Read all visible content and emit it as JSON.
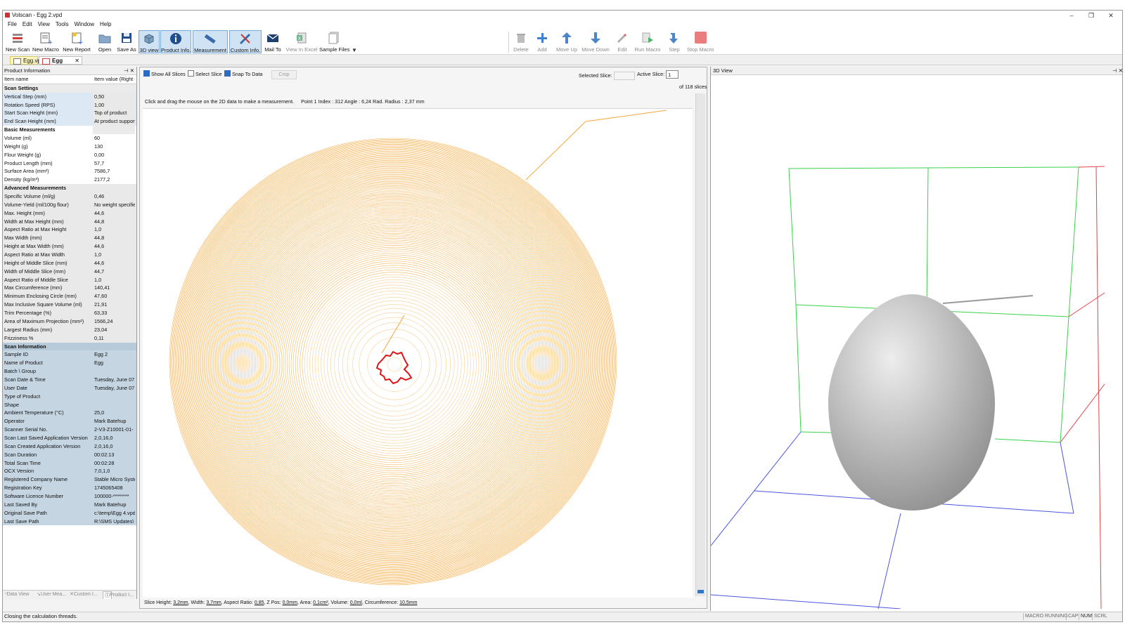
{
  "window": {
    "title": "Volscan - Egg 2.vpd",
    "controls": [
      "–",
      "❐",
      "✕"
    ]
  },
  "menu": [
    "File",
    "Edit",
    "View",
    "Tools",
    "Window",
    "Help"
  ],
  "toolbar": {
    "new_scan": "New Scan",
    "new_macro": "New Macro",
    "new_report": "New Report",
    "open": "Open",
    "save_as": "Save As",
    "view_3d": "3D view",
    "product_info": "Product Info.",
    "measurement": "Measurement",
    "custom_info": "Custom Info.",
    "mail_to": "Mail To",
    "view_in_excel": "View In Excel",
    "sample_files": "Sample Files",
    "delete": "Delete",
    "add": "Add",
    "move_up": "Move Up",
    "move_down": "Move Down",
    "edit": "Edit",
    "run_macro": "Run Macro",
    "step": "Step",
    "stop_macro": "Stop Macro"
  },
  "tabs": [
    {
      "label": "Egg.vpr"
    },
    {
      "label": "Egg 2.vpd",
      "close": "✕"
    }
  ],
  "left_panel": {
    "title": "Product Information",
    "header": {
      "name": "Item name",
      "value": "Item value (Right -"
    },
    "rows": [
      {
        "name": "Scan Settings",
        "value": "",
        "kind": "sec1"
      },
      {
        "name": "Vertical Step (mm)",
        "value": "0,50",
        "kind": "g1"
      },
      {
        "name": "Rotation Speed (RPS)",
        "value": "1,00",
        "kind": "g1"
      },
      {
        "name": "Start Scan Height (mm)",
        "value": "Top of product",
        "kind": "g1"
      },
      {
        "name": "End Scan Height (mm)",
        "value": "At product support",
        "kind": "g1"
      },
      {
        "name": "Basic Measurements",
        "value": "",
        "kind": "sec1w"
      },
      {
        "name": "Volume (ml)",
        "value": "60",
        "kind": "w"
      },
      {
        "name": "Weight (g)",
        "value": "130",
        "kind": "w"
      },
      {
        "name": "Flour Weight (g)",
        "value": "0,00",
        "kind": "w"
      },
      {
        "name": "Product Length (mm)",
        "value": "57,7",
        "kind": "w"
      },
      {
        "name": "Surface Area (mm²)",
        "value": "7586,7",
        "kind": "w"
      },
      {
        "name": "Density (kg/m³)",
        "value": "2177,2",
        "kind": "w"
      },
      {
        "name": "Advanced Measurements",
        "value": "",
        "kind": "sec2"
      },
      {
        "name": "Specific Volume (ml/g)",
        "value": "0,46",
        "kind": "g2"
      },
      {
        "name": "Volume-Yield (ml/100g flour)",
        "value": "No weight specified",
        "kind": "g2"
      },
      {
        "name": "Max. Height (mm)",
        "value": "44,6",
        "kind": "g2"
      },
      {
        "name": "Width at Max Height (mm)",
        "value": "44,8",
        "kind": "g2"
      },
      {
        "name": "Aspect Ratio at Max Height",
        "value": "1,0",
        "kind": "g2"
      },
      {
        "name": "Max Width (mm)",
        "value": "44,8",
        "kind": "g2"
      },
      {
        "name": "Height at Max Width (mm)",
        "value": "44,6",
        "kind": "g2"
      },
      {
        "name": "Aspect Ratio at Max Width",
        "value": "1,0",
        "kind": "g2"
      },
      {
        "name": "Height of Middle Slice (mm)",
        "value": "44,6",
        "kind": "g2"
      },
      {
        "name": "Width of Middle Slice (mm)",
        "value": "44,7",
        "kind": "g2"
      },
      {
        "name": "Aspect Ratio of Middle Slice",
        "value": "1,0",
        "kind": "g2"
      },
      {
        "name": "Max Circumference (mm)",
        "value": "140,41",
        "kind": "g2"
      },
      {
        "name": "Minimum Enclosing Circle (mm)",
        "value": "47,60",
        "kind": "g2"
      },
      {
        "name": "Max Inclusive Square Volume (ml)",
        "value": "21,91",
        "kind": "g2"
      },
      {
        "name": "Trim Percentage (%)",
        "value": "63,33",
        "kind": "g2"
      },
      {
        "name": "Area of Maximum Projection (mm²)",
        "value": "1566,24",
        "kind": "g2"
      },
      {
        "name": "Largest Radius (mm)",
        "value": "23,04",
        "kind": "g2"
      },
      {
        "name": "Frizziness %",
        "value": "0,11",
        "kind": "g2"
      },
      {
        "name": "Scan Information",
        "value": "",
        "kind": "sec3"
      },
      {
        "name": "Sample ID",
        "value": "Egg 2",
        "kind": "g3"
      },
      {
        "name": "Name of Product",
        "value": "Egg",
        "kind": "g3"
      },
      {
        "name": "Batch \\ Group",
        "value": "",
        "kind": "g3"
      },
      {
        "name": "Scan Date & Time",
        "value": "Tuesday, June 07,",
        "kind": "g3"
      },
      {
        "name": "User Date",
        "value": "Tuesday, June 07,",
        "kind": "g3"
      },
      {
        "name": "Type of Product",
        "value": "",
        "kind": "g3"
      },
      {
        "name": "Shape",
        "value": "",
        "kind": "g3"
      },
      {
        "name": "Ambient Temperature (°C)",
        "value": "25,0",
        "kind": "g3"
      },
      {
        "name": "Operator",
        "value": "Mark Batehup",
        "kind": "g3"
      },
      {
        "name": "Scanner Serial No.",
        "value": "2-V3-Z10001-01-",
        "kind": "g3"
      },
      {
        "name": "Scan Last Saved Application Version",
        "value": "2,0,16,0",
        "kind": "g3"
      },
      {
        "name": "Scan Created Application Version",
        "value": "2,0,16,0",
        "kind": "g3"
      },
      {
        "name": "Scan Duration",
        "value": "00:02:13",
        "kind": "g3"
      },
      {
        "name": "Total Scan Time",
        "value": "00:02:28",
        "kind": "g3"
      },
      {
        "name": "OCX Version",
        "value": "7,0,1,0",
        "kind": "g3"
      },
      {
        "name": "Registered Company Name",
        "value": "Stable Micro Systems",
        "kind": "g3"
      },
      {
        "name": "Registration Key",
        "value": "1745065408",
        "kind": "g3"
      },
      {
        "name": "Software Licence Number",
        "value": "100000-********",
        "kind": "g3"
      },
      {
        "name": "Last Saved By",
        "value": "Mark Batehup",
        "kind": "g3"
      },
      {
        "name": "Original Save Path",
        "value": "c:\\temp\\Egg 4.vpd",
        "kind": "g3"
      },
      {
        "name": "Last Save Path",
        "value": "R:\\SMS Updates\\",
        "kind": "g3"
      }
    ],
    "bottom_tabs": [
      "Data View",
      "User Mea...",
      "Custom I...",
      "Product I..."
    ]
  },
  "center": {
    "show_all_slices": "Show All Slices",
    "select_slice": "Select Slice",
    "snap_to_data": "Snap To Data",
    "crop": "Crop",
    "selected_slice_label": "Selected Slice:",
    "active_slice_label": "Active Slice:",
    "active_slice_value": "1",
    "slice_count": "of   118 slices",
    "hint": "Click and drag the mouse on the 2D data to make a measurement.",
    "point_info": "Point 1 Index : 312 Angle : 6,24 Rad. Radius : 2,37 mm",
    "status": {
      "slice_height_label": "Slice Height:",
      "slice_height": "3,2mm",
      "width_label": "Width:",
      "width": "3,7mm",
      "aspect_label": "Aspect Ratio:",
      "aspect": "0,85",
      "zpos_label": "Z Pos:",
      "zpos": "0,0mm",
      "area_label": "Area:",
      "area": "0,1cm²",
      "volume_label": "Volume:",
      "volume": "0,0ml",
      "circ_label": "Circumference:",
      "circ": "10,5mm"
    }
  },
  "view3d": {
    "title": "3D View"
  },
  "statusbar": {
    "message": "Closing the calculation threads.",
    "indicators": [
      "MACRO RUNNING",
      "CAP",
      "NUM",
      "SCRL"
    ]
  },
  "colors": {
    "slice_contour": "#f3a73a",
    "active_slice": "#e01414",
    "accent": "#3477c2",
    "box_green": "#38d24a",
    "box_red": "#e0444a",
    "box_blue": "#4a55e0"
  }
}
